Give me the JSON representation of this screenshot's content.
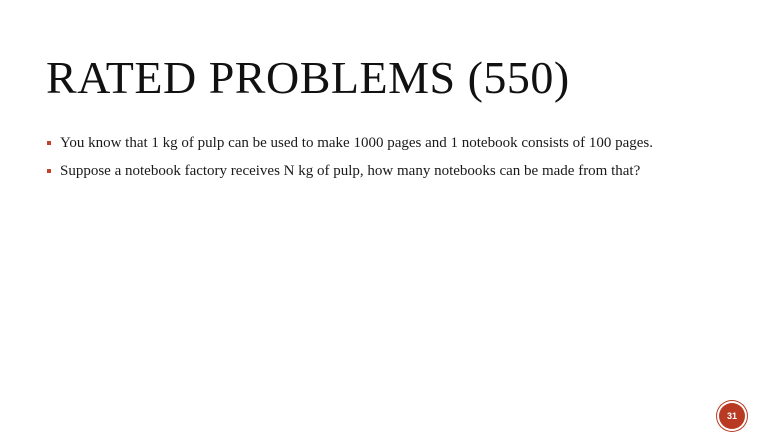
{
  "slide": {
    "title": "RATED PROBLEMS (550)",
    "bullets": [
      {
        "text": "You know that 1 kg of pulp can be used to make 1000 pages and 1 notebook consists of 100 pages."
      },
      {
        "text": "Suppose a notebook factory receives N kg of pulp, how many notebooks can be made from that?"
      }
    ],
    "page_number": "31"
  },
  "colors": {
    "accent": "#c0432a",
    "badge": "#b83a22",
    "text": "#1a1a1a"
  },
  "icons": {
    "bullet": "square-bullet-icon"
  }
}
